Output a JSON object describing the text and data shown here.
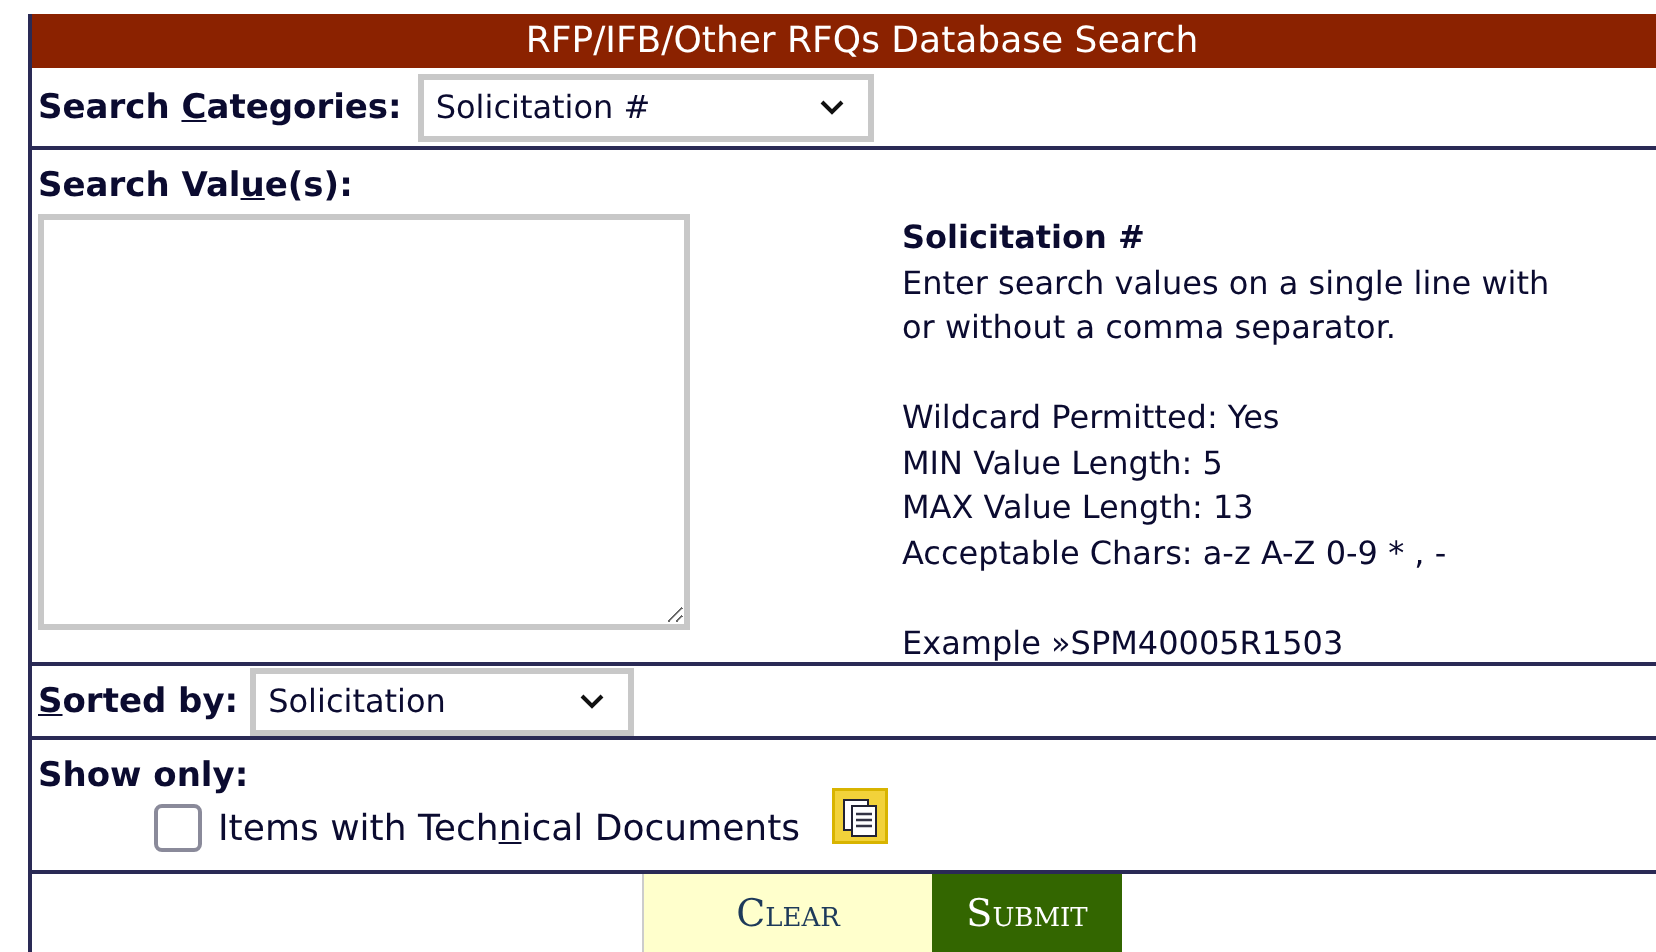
{
  "header": {
    "title": "RFP/IFB/Other RFQs Database Search"
  },
  "categories": {
    "label_parts": [
      "Search ",
      "C",
      "ategories:"
    ],
    "value": "Solicitation #"
  },
  "search_values": {
    "label_parts": [
      "Search Val",
      "u",
      "e(s):"
    ],
    "help": {
      "title": "Solicitation #",
      "paragraphs": [
        [
          "Enter search values on a single line with or without a comma separator."
        ],
        [
          "Wildcard Permitted: Yes",
          "MIN Value Length: 5",
          "MAX Value Length: 13",
          "Acceptable Chars: a-z A-Z 0-9 * , -"
        ],
        [
          "Example »SPM40005R1503"
        ]
      ]
    }
  },
  "sorted_by": {
    "label_key": "S",
    "label_rest": "orted by:",
    "value": "Solicitation"
  },
  "show_only": {
    "label": "Show only:",
    "options": [
      {
        "label_parts": [
          "Items with Tech",
          "n",
          "ical Documents"
        ],
        "checked": false
      }
    ]
  },
  "buttons": [
    {
      "kind": "clear",
      "label": "Clear"
    },
    {
      "kind": "submit",
      "label": "Submit"
    }
  ]
}
